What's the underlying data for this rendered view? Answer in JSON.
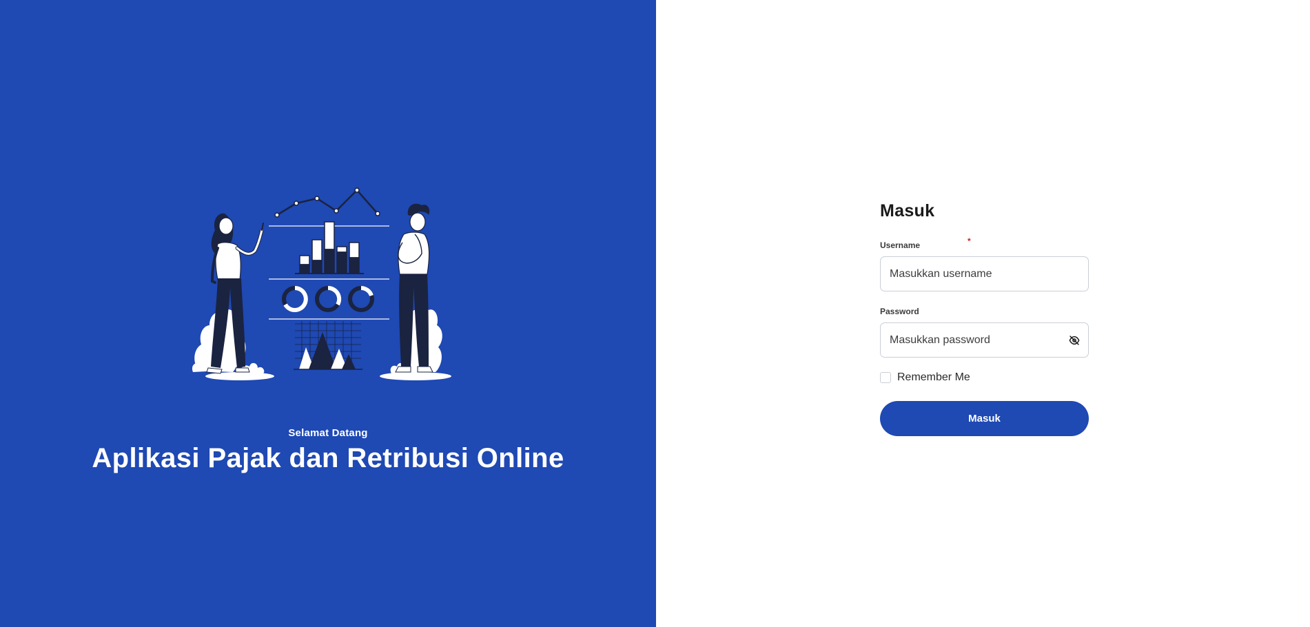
{
  "hero": {
    "subtitle": "Selamat Datang",
    "title": "Aplikasi Pajak dan Retribusi Online",
    "background_color": "#1f49b3"
  },
  "login": {
    "title": "Masuk",
    "username": {
      "label": "Username",
      "required_mark": "*",
      "placeholder": "Masukkan username",
      "value": ""
    },
    "password": {
      "label": "Password",
      "placeholder": "Masukkan password",
      "value": "",
      "toggle_icon": "eye-off-icon"
    },
    "remember_me": {
      "label": "Remember Me",
      "checked": false
    },
    "submit_label": "Masuk",
    "accent_color": "#1f49b3"
  }
}
